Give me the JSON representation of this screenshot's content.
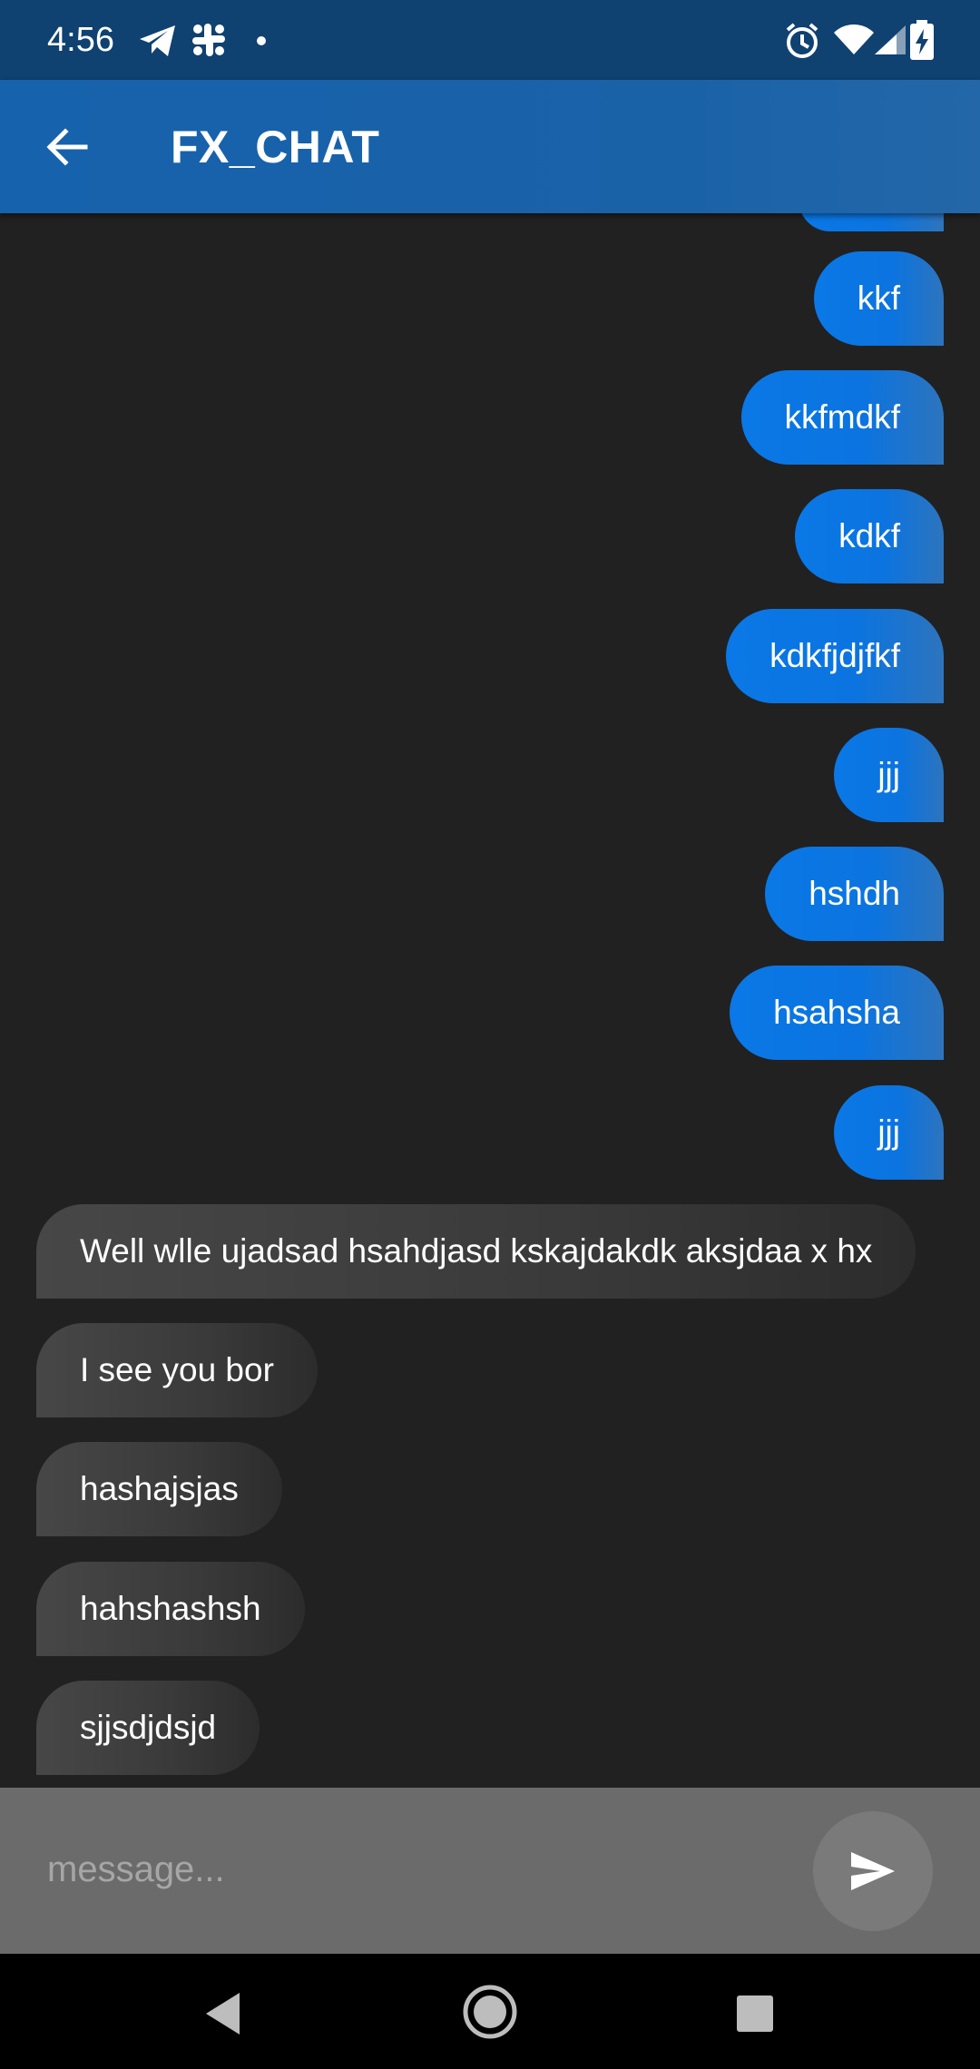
{
  "status_bar": {
    "time": "4:56",
    "notification_icons": [
      "telegram-icon",
      "slack-icon",
      "more-dot-icon"
    ],
    "system_icons": [
      "alarm-icon",
      "wifi-icon",
      "signal-icon",
      "battery-charging-icon"
    ]
  },
  "app_bar": {
    "title": "FX_CHAT",
    "back_icon": "arrow-left-icon"
  },
  "messages": [
    {
      "direction": "sent",
      "text": "kkf"
    },
    {
      "direction": "sent",
      "text": "kkfmdkf"
    },
    {
      "direction": "sent",
      "text": "kdkf"
    },
    {
      "direction": "sent",
      "text": "kdkfjdjfkf"
    },
    {
      "direction": "sent",
      "text": "jjj"
    },
    {
      "direction": "sent",
      "text": "hshdh"
    },
    {
      "direction": "sent",
      "text": "hsahsha"
    },
    {
      "direction": "sent",
      "text": "jjj"
    },
    {
      "direction": "received",
      "text": "Well wlle ujadsad hsahdjasd kskajdakdk aksjdaa x hx"
    },
    {
      "direction": "received",
      "text": "I see you bor"
    },
    {
      "direction": "received",
      "text": "hashajsjas"
    },
    {
      "direction": "received",
      "text": "hahshashsh"
    },
    {
      "direction": "received",
      "text": "sjjsdjdsjd"
    }
  ],
  "composer": {
    "placeholder": "message...",
    "value": "",
    "send_icon": "send-icon"
  },
  "nav_bar": {
    "icons": [
      "nav-back-icon",
      "nav-home-icon",
      "nav-recents-icon"
    ]
  },
  "colors": {
    "status_bar": "#0f4171",
    "app_bar": "#1762ad",
    "background": "#212121",
    "sent_bubble": "#0a78e6",
    "received_bubble": "#474747",
    "input_bar": "#6b6b6b",
    "send_button": "#7a7a7a"
  }
}
